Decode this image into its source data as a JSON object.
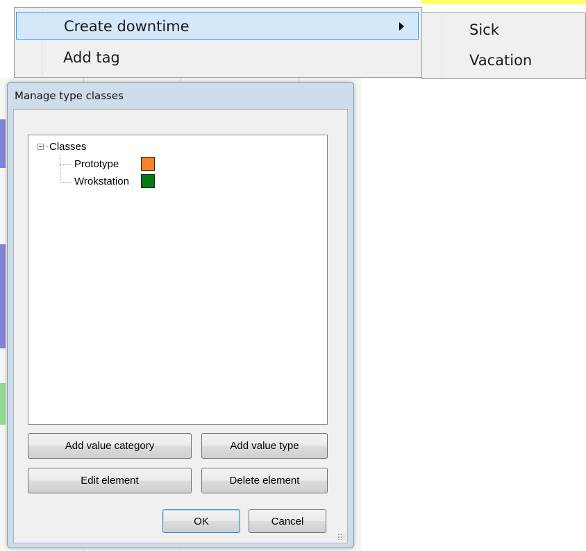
{
  "context_menu": {
    "items": [
      {
        "label": "Create downtime",
        "has_submenu": true,
        "highlighted": true
      },
      {
        "label": "Add tag",
        "has_submenu": false,
        "highlighted": false
      }
    ]
  },
  "submenu": {
    "items": [
      {
        "label": "Sick"
      },
      {
        "label": "Vacation"
      }
    ]
  },
  "dialog": {
    "title": "Manage type classes",
    "tree": {
      "root": {
        "label": "Classes",
        "expanded": true
      },
      "children": [
        {
          "label": "Prototype",
          "color": "#ff7f27"
        },
        {
          "label": "Wrokstation",
          "color": "#007a12"
        }
      ]
    },
    "buttons": {
      "add_value_category": "Add value category",
      "add_value_type": "Add value type",
      "edit_element": "Edit element",
      "delete_element": "Delete element",
      "ok": "OK",
      "cancel": "Cancel"
    }
  },
  "colors": {
    "menu_highlight": "#d5e7fb",
    "menu_highlight_border": "#3399ff",
    "dialog_frame": "#cfdcea"
  }
}
